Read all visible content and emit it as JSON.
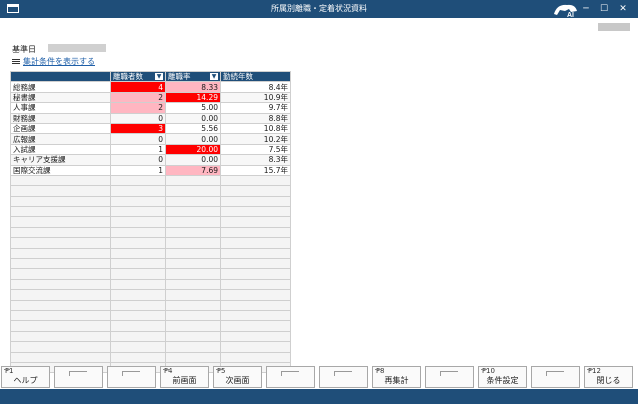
{
  "window": {
    "title": "所属別離職・定着状況資料"
  },
  "icons": {
    "app": "window-icon",
    "logo": "ai-logo-icon",
    "minimize": "minimize-icon",
    "maximize": "maximize-icon",
    "close": "close-icon",
    "list": "list-icon"
  },
  "criteria": {
    "date_label": "基準日",
    "date_value": "",
    "filter_link": "集計条件を表示する"
  },
  "colors": {
    "header": "#1f4e79",
    "highlight_red": "#ff0000",
    "highlight_pink": "#ffb6c1"
  },
  "table": {
    "columns": [
      "",
      "離職者数",
      "離職率",
      "勤続年数"
    ],
    "rows": [
      {
        "dept": "総務課",
        "count": "4",
        "rate": "8.33",
        "tenure": "8.4年",
        "count_hl": "red",
        "rate_hl": "pink"
      },
      {
        "dept": "秘書課",
        "count": "2",
        "rate": "14.29",
        "tenure": "10.9年",
        "count_hl": "pink",
        "rate_hl": "red"
      },
      {
        "dept": "人事課",
        "count": "2",
        "rate": "5.00",
        "tenure": "9.7年",
        "count_hl": "pink",
        "rate_hl": ""
      },
      {
        "dept": "財務課",
        "count": "0",
        "rate": "0.00",
        "tenure": "8.8年",
        "count_hl": "",
        "rate_hl": ""
      },
      {
        "dept": "企画課",
        "count": "3",
        "rate": "5.56",
        "tenure": "10.8年",
        "count_hl": "red",
        "rate_hl": ""
      },
      {
        "dept": "広報課",
        "count": "0",
        "rate": "0.00",
        "tenure": "10.2年",
        "count_hl": "",
        "rate_hl": ""
      },
      {
        "dept": "入試課",
        "count": "1",
        "rate": "20.00",
        "tenure": "7.5年",
        "count_hl": "",
        "rate_hl": "red"
      },
      {
        "dept": "キャリア支援課",
        "count": "0",
        "rate": "0.00",
        "tenure": "8.3年",
        "count_hl": "",
        "rate_hl": ""
      },
      {
        "dept": "国際交流課",
        "count": "1",
        "rate": "7.69",
        "tenure": "15.7年",
        "count_hl": "",
        "rate_hl": "pink"
      }
    ]
  },
  "fkeys": [
    {
      "key": "F1",
      "label": "ヘルプ"
    },
    {
      "key": "",
      "label": ""
    },
    {
      "key": "",
      "label": ""
    },
    {
      "key": "F4",
      "label": "前画面"
    },
    {
      "key": "F5",
      "label": "次画面"
    },
    {
      "key": "",
      "label": ""
    },
    {
      "key": "",
      "label": ""
    },
    {
      "key": "F8",
      "label": "再集計"
    },
    {
      "key": "",
      "label": ""
    },
    {
      "key": "F10",
      "label": "条件設定"
    },
    {
      "key": "",
      "label": ""
    },
    {
      "key": "F12",
      "label": "閉じる"
    }
  ]
}
